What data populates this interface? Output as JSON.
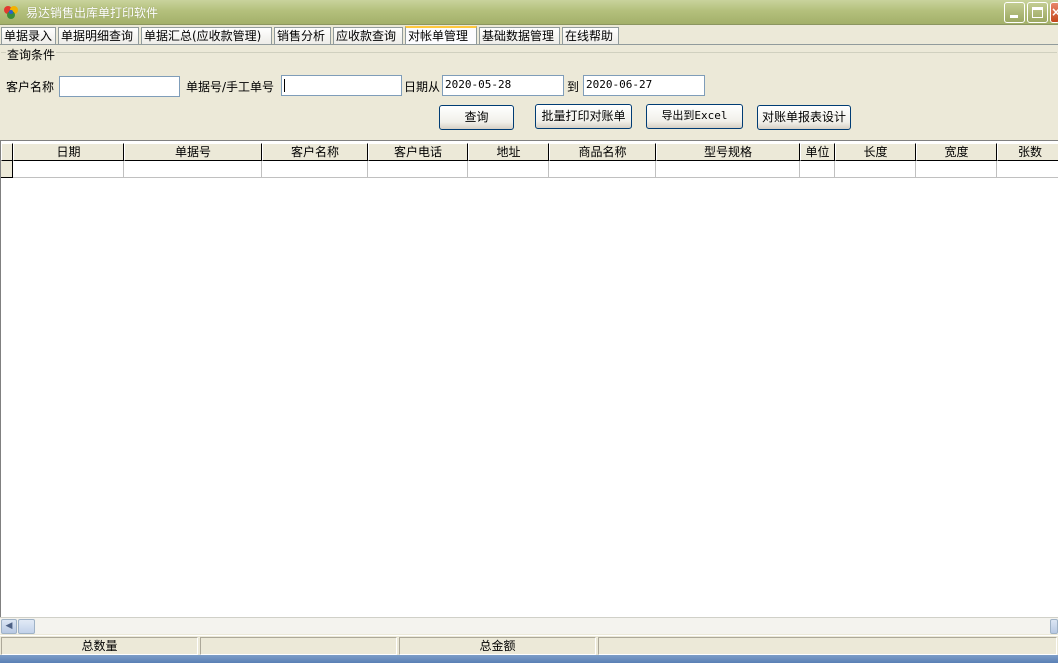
{
  "window": {
    "title": "易达销售出库单打印软件"
  },
  "tabs": [
    {
      "label": "单据录入"
    },
    {
      "label": "单据明细查询"
    },
    {
      "label": "单据汇总(应收款管理)"
    },
    {
      "label": "销售分析"
    },
    {
      "label": "应收款查询"
    },
    {
      "label": "对帐单管理",
      "active": true
    },
    {
      "label": "基础数据管理"
    },
    {
      "label": "在线帮助"
    }
  ],
  "query": {
    "group_title": "查询条件",
    "customer_label": "客户名称",
    "customer_value": "",
    "doc_no_label": "单据号/手工单号",
    "doc_no_value": "",
    "date_from_label": "日期从",
    "date_from": "2020-05-28",
    "date_to_label": "到",
    "date_to": "2020-06-27",
    "buttons": {
      "search": "查询",
      "batch_print": "批量打印对账单",
      "export": "导出到Excel",
      "report_design": "对账单报表设计"
    }
  },
  "table": {
    "columns": [
      "日期",
      "单据号",
      "客户名称",
      "客户电话",
      "地址",
      "商品名称",
      "型号规格",
      "单位",
      "长度",
      "宽度",
      "张数"
    ],
    "rows": []
  },
  "status": {
    "total_qty_label": "总数量",
    "total_qty_value": "",
    "total_amount_label": "总金额",
    "total_amount_value": ""
  },
  "icons": {
    "app": "app-logo-icon",
    "minimize": "minimize-icon",
    "maximize": "maximize-icon",
    "close": "close-icon",
    "scroll_left": "arrow-left-icon",
    "scroll_right": "arrow-right-icon"
  },
  "colors": {
    "titlebar": "#B4C07C",
    "window_bg": "#ECE9D8",
    "active_tab_accent": "#FFC83C",
    "close_button": "#C4461C"
  }
}
